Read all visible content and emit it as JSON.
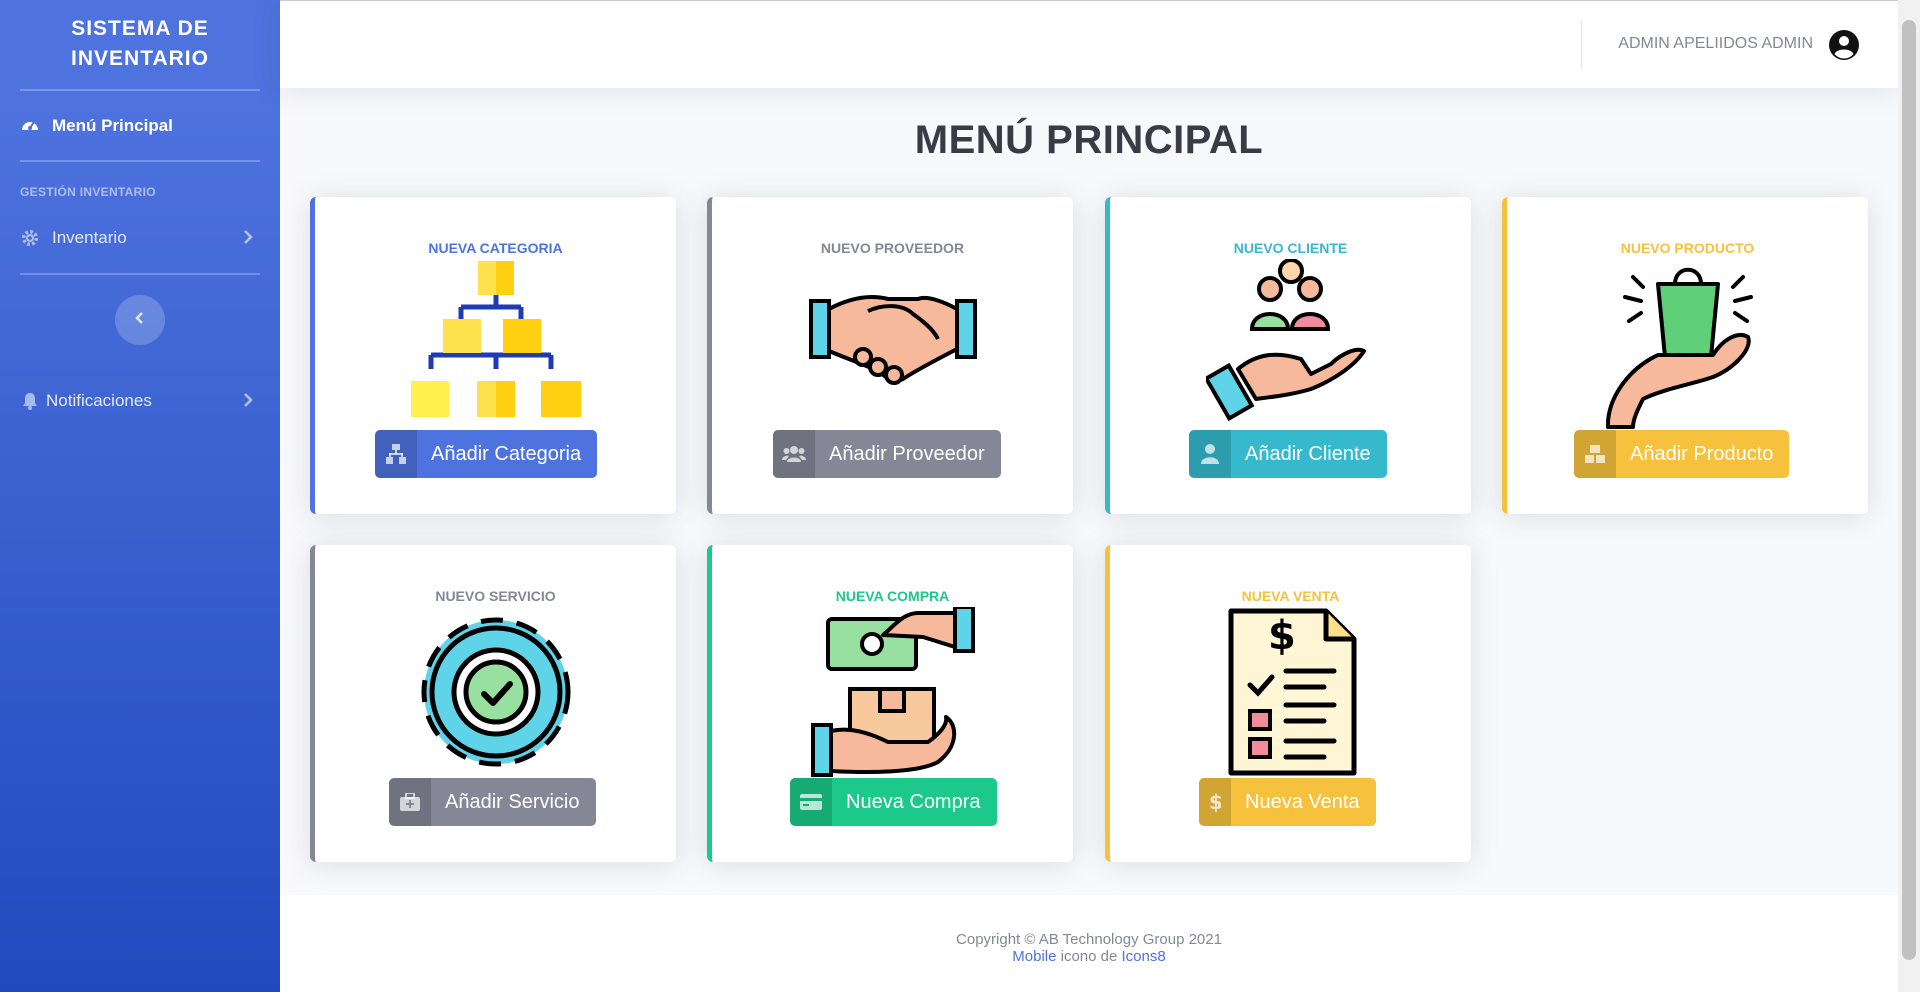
{
  "sidebar": {
    "brand": "SISTEMA DE INVENTARIO",
    "dashboard_label": "Menú Principal",
    "section_heading": "GESTIÓN INVENTARIO",
    "inventory_label": "Inventario",
    "notifications_label": "Notificaciones",
    "icons": {
      "dashboard": "tachometer-icon",
      "inventory": "gear-icon",
      "notifications": "bell-icon",
      "toggle": "chevron-left-icon"
    }
  },
  "topbar": {
    "user_name": "ADMIN APELIIDOS ADMIN",
    "avatar_icon": "user-circle-icon"
  },
  "page": {
    "title": "MENÚ PRINCIPAL"
  },
  "cards": {
    "categoria": {
      "title": "NUEVA CATEGORIA",
      "button": "Añadir Categoria",
      "icon": "sitemap-icon",
      "color": "#4e73df"
    },
    "proveedor": {
      "title": "NUEVO PROVEEDOR",
      "button": "Añadir Proveedor",
      "icon": "users-icon",
      "color": "#858796"
    },
    "cliente": {
      "title": "NUEVO CLIENTE",
      "button": "Añadir Cliente",
      "icon": "user-icon",
      "color": "#36b9cc"
    },
    "producto": {
      "title": "NUEVO PRODUCTO",
      "button": "Añadir Producto",
      "icon": "boxes-icon",
      "color": "#f6c23e"
    },
    "servicio": {
      "title": "NUEVO SERVICIO",
      "button": "Añadir Servicio",
      "icon": "briefcase-medical-icon",
      "color": "#858796"
    },
    "compra": {
      "title": "NUEVA COMPRA",
      "button": "Nueva Compra",
      "icon": "credit-card-icon",
      "color": "#1cc88a"
    },
    "venta": {
      "title": "NUEVA VENTA",
      "button": "Nueva Venta",
      "icon": "dollar-icon",
      "color": "#f6c23e"
    }
  },
  "footer": {
    "copyright": "Copyright © AB Technology Group 2021",
    "link_mobile": "Mobile",
    "credit_text": " icono de ",
    "link_icons8": "Icons8"
  }
}
